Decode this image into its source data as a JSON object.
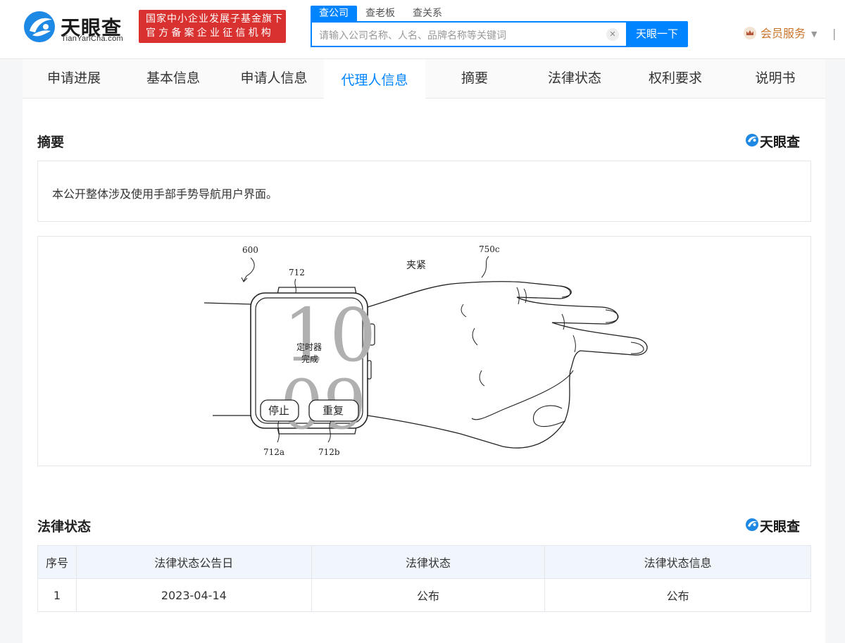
{
  "header": {
    "logo_text": "天眼查",
    "logo_domain": "TianYanCha.com",
    "badge_line1": "国家中小企业发展子基金旗下",
    "badge_line2": "官方备案企业征信机构",
    "search_tabs": [
      "查公司",
      "查老板",
      "查关系"
    ],
    "search_placeholder": "请输入公司名称、人名、品牌名称等关键词",
    "search_button": "天眼一下",
    "member_label": "会员服务"
  },
  "nav": {
    "tabs": [
      "申请进展",
      "基本信息",
      "申请人信息",
      "代理人信息",
      "摘要",
      "法律状态",
      "权利要求",
      "说明书"
    ],
    "active_index": 3
  },
  "abstract": {
    "title": "摘要",
    "brand": "天眼查",
    "text": "本公开整体涉及使用手部手势导航用户界面。"
  },
  "figure": {
    "labels": {
      "fig_ref": "600",
      "screen_ref": "712",
      "hand_ref": "750c",
      "gesture": "夹紧",
      "time_hour": "10",
      "time_min": "09",
      "notify_line1": "定时器",
      "notify_line2": "完成",
      "stop_btn": "停止",
      "repeat_btn": "重复",
      "stop_ref": "712a",
      "repeat_ref": "712b"
    }
  },
  "legal": {
    "title": "法律状态",
    "brand": "天眼查",
    "columns": [
      "序号",
      "法律状态公告日",
      "法律状态",
      "法律状态信息"
    ],
    "rows": [
      [
        "1",
        "2023-04-14",
        "公布",
        "公布"
      ]
    ]
  },
  "colors": {
    "accent": "#0084ff",
    "badge_red": "#d9312f",
    "member_orange": "#c9752c"
  }
}
